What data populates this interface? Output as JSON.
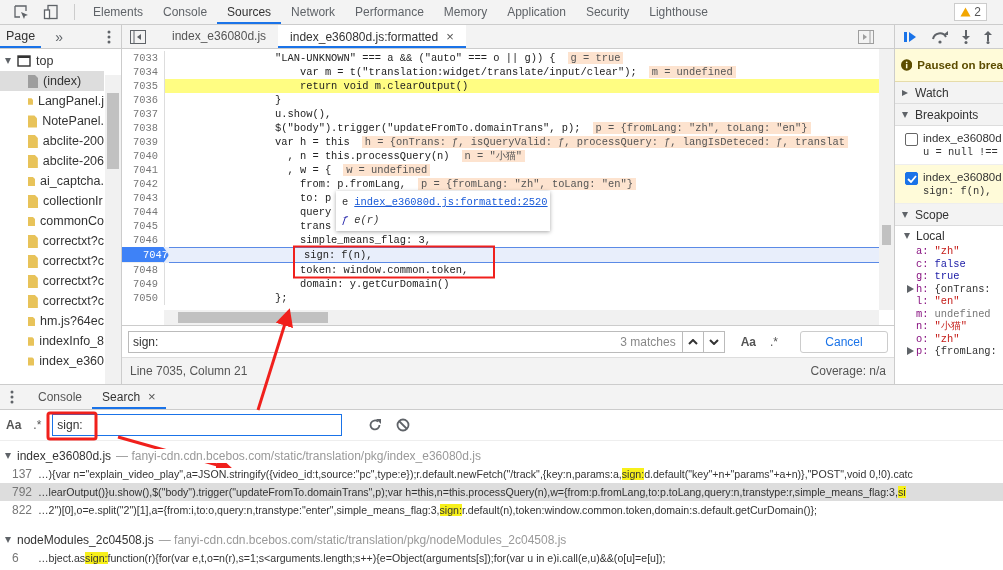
{
  "toolbar": {
    "tabs": [
      {
        "label": "Elements",
        "selected": false
      },
      {
        "label": "Console",
        "selected": false
      },
      {
        "label": "Sources",
        "selected": true
      },
      {
        "label": "Network",
        "selected": false
      },
      {
        "label": "Performance",
        "selected": false
      },
      {
        "label": "Memory",
        "selected": false
      },
      {
        "label": "Application",
        "selected": false
      },
      {
        "label": "Security",
        "selected": false
      },
      {
        "label": "Lighthouse",
        "selected": false
      }
    ],
    "warnings": "2"
  },
  "navigator": {
    "tabs": [
      {
        "label": "Page",
        "selected": true
      }
    ],
    "more": "»",
    "tree": [
      {
        "label": "top",
        "kind": "frame",
        "expanded": true,
        "selected": false,
        "children": [
          {
            "label": "(index)",
            "kind": "document",
            "selected": true
          },
          {
            "label": "LangPanel.j",
            "kind": "script",
            "selected": false
          },
          {
            "label": "NotePanel.",
            "kind": "script",
            "selected": false
          },
          {
            "label": "abclite-200",
            "kind": "script",
            "selected": false
          },
          {
            "label": "abclite-206",
            "kind": "script",
            "selected": false
          },
          {
            "label": "ai_captcha.",
            "kind": "script",
            "selected": false
          },
          {
            "label": "collectionIr",
            "kind": "script",
            "selected": false
          },
          {
            "label": "commonCo",
            "kind": "script",
            "selected": false
          },
          {
            "label": "correctxt?c",
            "kind": "script",
            "selected": false
          },
          {
            "label": "correctxt?c",
            "kind": "script",
            "selected": false
          },
          {
            "label": "correctxt?c",
            "kind": "script",
            "selected": false
          },
          {
            "label": "correctxt?c",
            "kind": "script",
            "selected": false
          },
          {
            "label": "hm.js?64ec",
            "kind": "script",
            "selected": false
          },
          {
            "label": "indexInfo_8",
            "kind": "script",
            "selected": false
          },
          {
            "label": "index_e360",
            "kind": "script",
            "selected": false
          }
        ]
      }
    ]
  },
  "editor": {
    "tabs": [
      {
        "label": "index_e36080d.js",
        "selected": false
      },
      {
        "label": "index_e36080d.js:formatted",
        "selected": true,
        "close": "×"
      }
    ],
    "lines": [
      {
        "num": "7033",
        "text": "\"LAN-UNKNOWN\" === a && (\"auto\" === o || g)) {",
        "value": "g = true",
        "kind": "normal",
        "breakpoint": false
      },
      {
        "num": "7034",
        "text": "    var m = t(\"translation:widget/translate/input/clear\");",
        "value": "m = undefined",
        "kind": "normal",
        "breakpoint": false
      },
      {
        "num": "7035",
        "text": "    return void m.clearOutput()",
        "kind": "paused",
        "breakpoint": false
      },
      {
        "num": "7036",
        "text": "}",
        "kind": "normal",
        "breakpoint": false
      },
      {
        "num": "7037",
        "text": "u.show(),",
        "kind": "normal",
        "breakpoint": false
      },
      {
        "num": "7038",
        "text": "$(\"body\").trigger(\"updateFromTo.domainTrans\", p);",
        "value": "p = {fromLang: \"zh\", toLang: \"en\"}",
        "kind": "normal",
        "breakpoint": false
      },
      {
        "num": "7039",
        "text": "var h = this",
        "value": "h = {onTrans: ƒ, isQueryValid: ƒ, processQuery: ƒ, langIsDeteced: ƒ, translat",
        "kind": "normal",
        "breakpoint": false
      },
      {
        "num": "7040",
        "text": "  , n = this.processQuery(n)",
        "value": "n = \"小猫\"",
        "kind": "normal",
        "breakpoint": false
      },
      {
        "num": "7041",
        "text": "  , w = {",
        "value": "w = undefined",
        "kind": "normal",
        "breakpoint": false
      },
      {
        "num": "7042",
        "text": "    from: p.fromLang,",
        "value": "p = {fromLang: \"zh\", toLang: \"en\"}",
        "kind": "normal",
        "breakpoint": false
      },
      {
        "num": "7043",
        "text": "    to: p",
        "kind": "normal",
        "breakpoint": false
      },
      {
        "num": "7044",
        "text": "    query",
        "kind": "normal",
        "breakpoint": false
      },
      {
        "num": "7045",
        "text": "    trans",
        "kind": "normal",
        "breakpoint": false
      },
      {
        "num": "7046",
        "text": "    simple_means_flag: 3,",
        "kind": "normal",
        "breakpoint": false
      },
      {
        "num": "7047",
        "text": "    sign: f(n),",
        "kind": "current",
        "breakpoint": true
      },
      {
        "num": "7048",
        "text": "    token: window.common.token,",
        "kind": "normal",
        "breakpoint": false
      },
      {
        "num": "7049",
        "text": "    domain: y.getCurDomain()",
        "kind": "normal",
        "breakpoint": false
      },
      {
        "num": "7050",
        "text": "};",
        "kind": "normal",
        "breakpoint": false
      }
    ],
    "popover": {
      "name": "e",
      "link": "index_e36080d.js:formatted:2520",
      "keyword": "ƒ",
      "signature": "e(r)"
    },
    "search": {
      "value": "sign:",
      "matches": "3 matches",
      "case": "Aa",
      "regex": ".*",
      "cancel": "Cancel"
    },
    "status": {
      "position": "Line 7035, Column 21",
      "coverage": "Coverage: n/a"
    }
  },
  "debugger": {
    "paused": "Paused on brea",
    "watch": {
      "title": "Watch",
      "expanded": false
    },
    "breakpoints": {
      "title": "Breakpoints",
      "expanded": true,
      "items": [
        {
          "file": "index_e36080d",
          "code": "u = null !==",
          "checked": false,
          "hit": false
        },
        {
          "file": "index_e36080d",
          "code": "sign: f(n),",
          "checked": true,
          "hit": true
        }
      ]
    },
    "scope": {
      "title": "Scope",
      "expanded": true,
      "local": {
        "title": "Local",
        "expanded": true,
        "vars": [
          {
            "name": "a:",
            "value": "\"zh\"",
            "kind": "string",
            "expandable": false
          },
          {
            "name": "c:",
            "value": "false",
            "kind": "keyword",
            "expandable": false
          },
          {
            "name": "g:",
            "value": "true",
            "kind": "keyword",
            "expandable": false
          },
          {
            "name": "h:",
            "value": "{onTrans:",
            "kind": "object",
            "expandable": true
          },
          {
            "name": "l:",
            "value": "\"en\"",
            "kind": "string",
            "expandable": false
          },
          {
            "name": "m:",
            "value": "undefined",
            "kind": "undefined",
            "expandable": false
          },
          {
            "name": "n:",
            "value": "\"小猫\"",
            "kind": "string",
            "expandable": false
          },
          {
            "name": "o:",
            "value": "\"zh\"",
            "kind": "string",
            "expandable": false
          },
          {
            "name": "p:",
            "value": "{fromLang:",
            "kind": "object",
            "expandable": true
          }
        ]
      }
    }
  },
  "drawer": {
    "tabs": [
      {
        "label": "Console",
        "selected": false
      },
      {
        "label": "Search",
        "selected": true,
        "close": "×"
      }
    ],
    "search": {
      "case": "Aa",
      "regex": ".*",
      "value": "sign:"
    },
    "results": [
      {
        "file": "index_e36080d.js",
        "url": "— fanyi-cdn.cdn.bcebos.com/static/translation/pkg/index_e36080d.js",
        "expanded": true,
        "matches": [
          {
            "line": "137",
            "before": "…){var n=\"explain_video_play\",a=JSON.stringify({video_id:t,source:\"pc\",type:e});r.default.newFetch(\"/track\",{key:n,params:a,",
            "match": "sign:",
            "after": "d.default(\"key\"+n+\"params\"+a+n)},\"POST\",void 0,!0).catc",
            "selected": false
          },
          {
            "line": "792",
            "before": "…learOutput()}u.show(),$(\"body\").trigger(\"updateFromTo.domainTrans\",p);var h=this,n=this.processQuery(n),w={from:p.fromLang,to:p.toLang,query:n,transtype:r,simple_means_flag:3,",
            "match": "si",
            "selected": true
          },
          {
            "line": "822",
            "before": "…2\")[0],o=e.split(\"2\")[1],a={from:i,to:o,query:n,transtype:\"enter\",simple_means_flag:3,",
            "match": "sign:",
            "after": "r.default(n),token:window.common.token,domain:s.default.getCurDomain()};",
            "selected": false
          }
        ]
      },
      {
        "file": "nodeModules_2c04508.js",
        "url": "— fanyi-cdn.cdn.bcebos.com/static/translation/pkg/nodeModules_2c04508.js",
        "expanded": true,
        "matches": [
          {
            "line": "6",
            "before": "…bject.as",
            "match": "sign:",
            "after": "function(r){for(var e,t,o=n(r),s=1;s<arguments.length;s++){e=Object(arguments[s]);for(var u in e)i.call(e,u)&&(o[u]=e[u]);",
            "selected": false
          }
        ]
      }
    ]
  }
}
